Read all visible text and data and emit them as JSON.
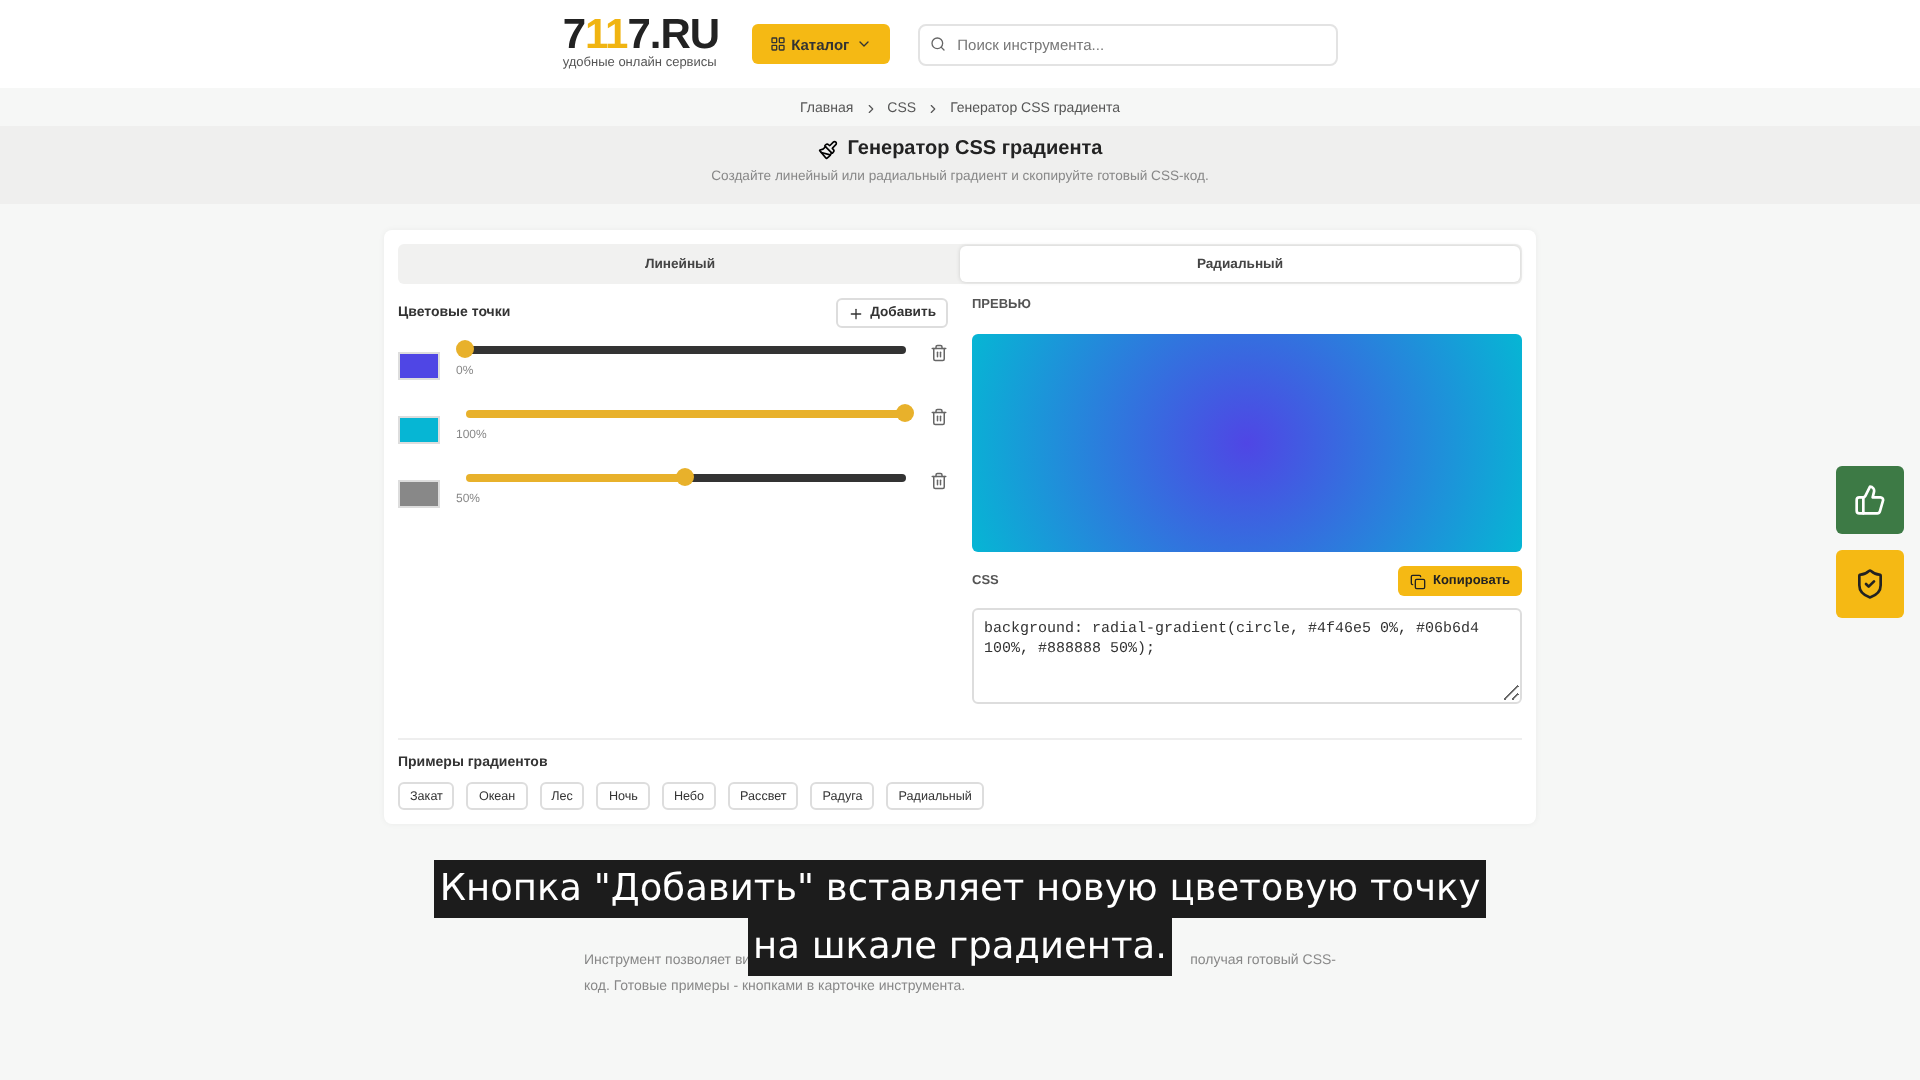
{
  "header": {
    "logo": {
      "prefix": "7",
      "accent": "11",
      "suffix": "7.RU",
      "tagline": "удобные онлайн сервисы"
    },
    "catalog_button": "Каталог",
    "search": {
      "placeholder": "Поиск инструмента..."
    }
  },
  "breadcrumbs": [
    "Главная",
    "CSS",
    "Генератор CSS градиента"
  ],
  "page": {
    "title": "Генератор CSS градиента",
    "subtitle": "Создайте линейный или радиальный градиент и скопируйте готовый CSS-код."
  },
  "tabs": [
    {
      "label": "Линейный",
      "selected": false
    },
    {
      "label": "Радиальный",
      "selected": true
    }
  ],
  "stops": {
    "title": "Цветовые точки",
    "add_button": "Добавить",
    "items": [
      {
        "color": "#4f46e5",
        "level": 0,
        "reading": "0%"
      },
      {
        "color": "#06b6d4",
        "level": 1,
        "reading": "100%"
      },
      {
        "color": "#888888",
        "level": 0.5,
        "reading": "50%"
      }
    ]
  },
  "preview": {
    "label": "ПРЕВЬЮ"
  },
  "css": {
    "label": "CSS",
    "copy_button": "Копировать",
    "value": "background: radial-gradient(circle, #4f46e5 0%, #06b6d4 100%, #888888 50%);"
  },
  "examples": {
    "title": "Примеры градиентов",
    "items": [
      "Закат",
      "Океан",
      "Лес",
      "Ночь",
      "Небо",
      "Рассвет",
      "Радуга",
      "Радиальный"
    ]
  },
  "description": {
    "line1_start": "Инструмент позволяет ви",
    "line1_end": "получая готовый CSS-",
    "line2": "код. Готовые примеры - кнопками в карточке инструмента."
  },
  "caption": {
    "lines": [
      "Кнопка \"Добавить\" вставляет новую цветовую точку",
      "на шкале градиента."
    ]
  }
}
